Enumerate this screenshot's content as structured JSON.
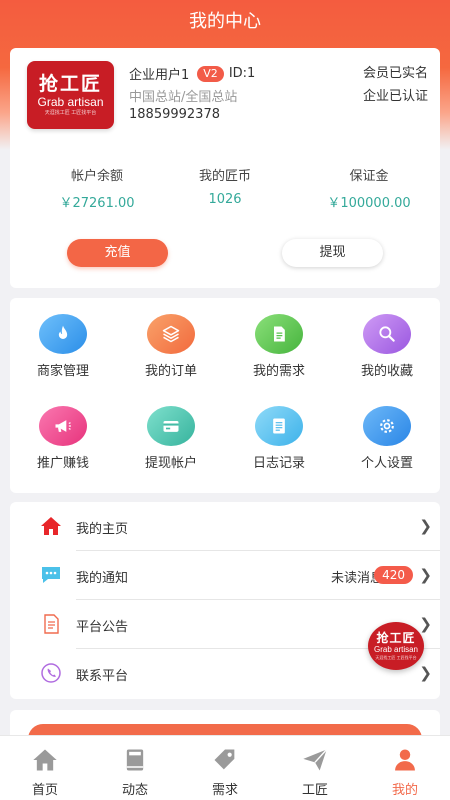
{
  "header": {
    "title": "我的中心"
  },
  "profile": {
    "logo_cn": "抢工匠",
    "logo_en": "Grab artisan",
    "logo_tagline": "天涯找工匠 工匠找平台",
    "user_name": "企业用户1",
    "vip_badge": "V2",
    "user_id": "ID:1",
    "station": "中国总站/全国总站",
    "phone": "18859992378",
    "member_status": "会员已实名",
    "company_status": "企业已认证"
  },
  "stats": [
    {
      "label": "帐户余额",
      "value": "￥27261.00"
    },
    {
      "label": "我的匠币",
      "value": "1026"
    },
    {
      "label": "保证金",
      "value": "￥100000.00"
    }
  ],
  "actions": {
    "recharge": "充值",
    "withdraw": "提现"
  },
  "grid": [
    {
      "label": "商家管理",
      "icon": "flame-icon",
      "color": "#4aa8f3"
    },
    {
      "label": "我的订单",
      "icon": "layers-icon",
      "color": "#f4834f"
    },
    {
      "label": "我的需求",
      "icon": "document-icon",
      "color": "#67cc5b"
    },
    {
      "label": "我的收藏",
      "icon": "search-icon",
      "color": "#b77ae8"
    },
    {
      "label": "推广赚钱",
      "icon": "megaphone-icon",
      "color": "#f04e93"
    },
    {
      "label": "提现帐户",
      "icon": "card-icon",
      "color": "#4fcbb5"
    },
    {
      "label": "日志记录",
      "icon": "log-icon",
      "color": "#5bc6f1"
    },
    {
      "label": "个人设置",
      "icon": "gear-icon",
      "color": "#3f9cf0"
    }
  ],
  "menu": [
    {
      "label": "我的主页",
      "icon": "home-icon"
    },
    {
      "label": "我的通知",
      "icon": "chat-icon",
      "extra": "未读消息",
      "badge": "420"
    },
    {
      "label": "平台公告",
      "icon": "announcement-icon"
    },
    {
      "label": "联系平台",
      "icon": "phone-icon"
    }
  ],
  "tabs": [
    {
      "label": "首页",
      "icon": "home-icon",
      "active": false
    },
    {
      "label": "动态",
      "icon": "book-icon",
      "active": false
    },
    {
      "label": "需求",
      "icon": "tag-icon",
      "active": false
    },
    {
      "label": "工匠",
      "icon": "send-icon",
      "active": false
    },
    {
      "label": "我的",
      "icon": "user-icon",
      "active": true
    }
  ],
  "colors": {
    "accent": "#f26a4b",
    "money": "#34a99a",
    "badge": "#f45b4a"
  }
}
